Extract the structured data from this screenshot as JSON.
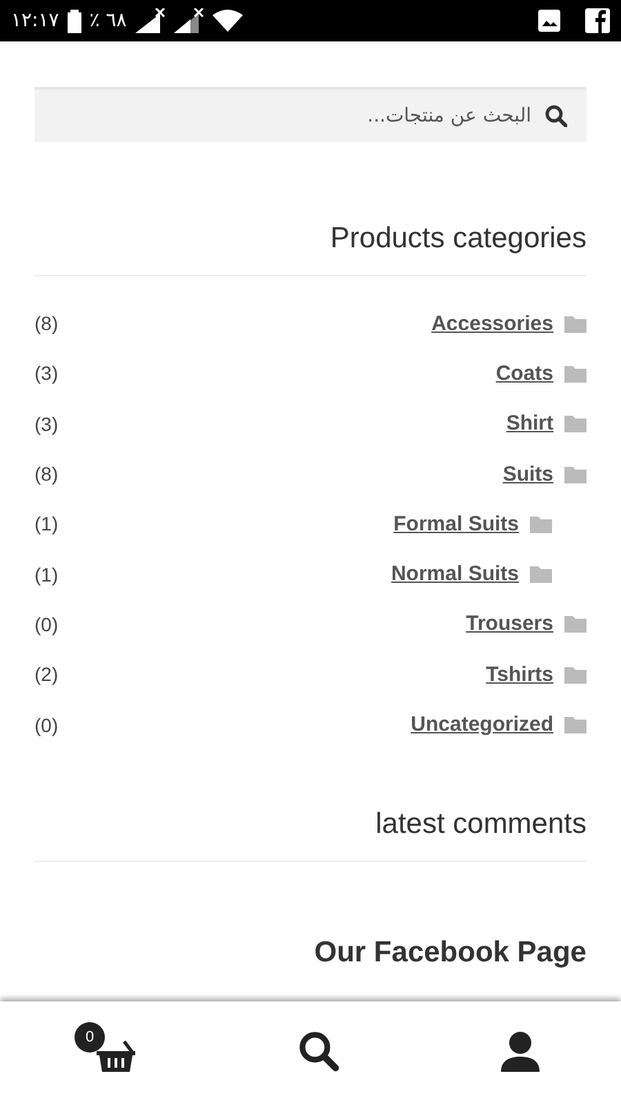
{
  "status_bar": {
    "time": "١٢:١٧",
    "battery_text": "٪ ٦٨"
  },
  "search": {
    "placeholder": "البحث عن منتجات..."
  },
  "categories_title": "Products categories",
  "categories": [
    {
      "name": "Accessories",
      "count": "(8)"
    },
    {
      "name": "Coats",
      "count": "(3)"
    },
    {
      "name": "Shirt",
      "count": "(3)"
    },
    {
      "name": "Suits",
      "count": "(8)",
      "children": [
        {
          "name": "Formal Suits",
          "count": "(1)"
        },
        {
          "name": "Normal Suits",
          "count": "(1)"
        }
      ]
    },
    {
      "name": "Trousers",
      "count": "(0)"
    },
    {
      "name": "Tshirts",
      "count": "(2)"
    },
    {
      "name": "Uncategorized",
      "count": "(0)"
    }
  ],
  "comments_title": "latest comments",
  "facebook_title": "Our Facebook Page",
  "bottom_nav": {
    "cart_count": "0"
  }
}
